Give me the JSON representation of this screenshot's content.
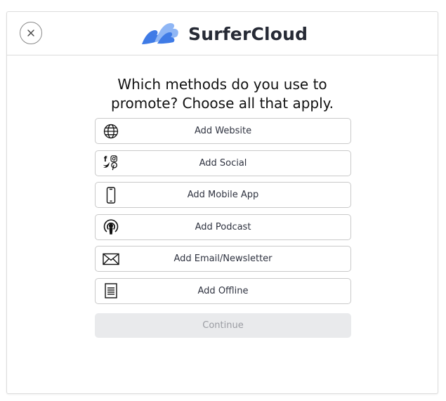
{
  "header": {
    "brand_name": "SurferCloud",
    "close_icon": "close-icon",
    "logo_icon": "surfercloud-wave-logo"
  },
  "question": "Which methods do you use to promote? Choose all that apply.",
  "options": [
    {
      "label": "Add Website",
      "icon": "globe-icon"
    },
    {
      "label": "Add Social",
      "icon": "social-icons"
    },
    {
      "label": "Add Mobile App",
      "icon": "mobile-phone-icon"
    },
    {
      "label": "Add Podcast",
      "icon": "podcast-icon"
    },
    {
      "label": "Add Email/Newsletter",
      "icon": "envelope-icon"
    },
    {
      "label": "Add Offline",
      "icon": "document-icon"
    }
  ],
  "continue_label": "Continue",
  "colors": {
    "brand_blue": "#3f7be6",
    "brand_light_blue": "#8fb6f5",
    "border": "#c9c9c9",
    "disabled_bg": "#e9eaec",
    "disabled_text": "#9a9ca2"
  }
}
